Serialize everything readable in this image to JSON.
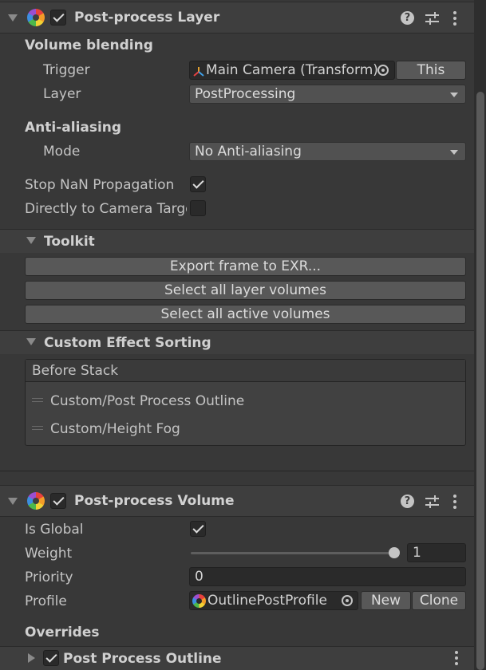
{
  "post_process_layer": {
    "title": "Post-process Layer",
    "volume_blending": {
      "heading": "Volume blending",
      "trigger_label": "Trigger",
      "trigger_value": "Main Camera (Transform)",
      "this_button": "This",
      "layer_label": "Layer",
      "layer_value": "PostProcessing"
    },
    "anti_aliasing": {
      "heading": "Anti-aliasing",
      "mode_label": "Mode",
      "mode_value": "No Anti-aliasing"
    },
    "stop_nan_label": "Stop NaN Propagation",
    "stop_nan_checked": true,
    "directly_to_camera_label": "Directly to Camera Target",
    "directly_to_camera_checked": false,
    "toolkit": {
      "heading": "Toolkit",
      "export_button": "Export frame to EXR...",
      "select_layer_button": "Select all layer volumes",
      "select_active_button": "Select all active volumes"
    },
    "custom_effect_sorting": {
      "heading": "Custom Effect Sorting",
      "list_header": "Before Stack",
      "items": [
        "Custom/Post Process Outline",
        "Custom/Height Fog"
      ]
    }
  },
  "post_process_volume": {
    "title": "Post-process Volume",
    "is_global_label": "Is Global",
    "is_global_checked": true,
    "weight_label": "Weight",
    "weight_value": "1",
    "priority_label": "Priority",
    "priority_value": "0",
    "profile_label": "Profile",
    "profile_value": "OutlinePostProfile",
    "new_button": "New",
    "clone_button": "Clone",
    "overrides_heading": "Overrides",
    "override_item": "Post Process Outline"
  },
  "icons": {
    "component": "postprocess-logo-icon",
    "help": "help-icon",
    "presets": "presets-icon",
    "menu": "kebab-menu-icon",
    "object_picker": "object-picker-icon",
    "transform": "transform-icon"
  }
}
